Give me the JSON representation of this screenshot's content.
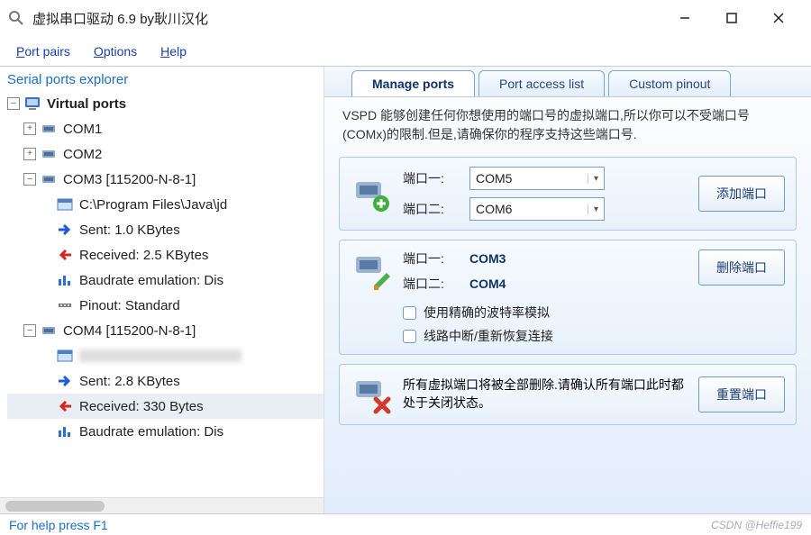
{
  "window": {
    "title": "虚拟串口驱动 6.9 by耿川汉化"
  },
  "menu": {
    "port_pairs": "Port pairs",
    "options": "Options",
    "help": "Help"
  },
  "tree": {
    "title": "Serial ports explorer",
    "root": "Virtual ports",
    "com1": "COM1",
    "com2": "COM2",
    "com3": "COM3 [115200-N-8-1]",
    "com3_path": "C:\\Program Files\\Java\\jd",
    "com3_sent": "Sent: 1.0 KBytes",
    "com3_recv": "Received: 2.5 KBytes",
    "com3_baud": "Baudrate emulation: Dis",
    "com3_pinout": "Pinout: Standard",
    "com4": "COM4 [115200-N-8-1]",
    "com4_path": " ",
    "com4_sent": "Sent: 2.8 KBytes",
    "com4_recv": "Received: 330 Bytes",
    "com4_baud": "Baudrate emulation: Dis"
  },
  "tabs": {
    "manage": "Manage ports",
    "access": "Port access list",
    "pinout": "Custom pinout"
  },
  "desc": "VSPD 能够创建任何你想使用的端口号的虚拟端口,所以你可以不受端口号(COMx)的限制.但是,请确保你的程序支持这些端口号.",
  "add": {
    "p1_label": "端口一:",
    "p1_value": "COM5",
    "p2_label": "端口二:",
    "p2_value": "COM6",
    "btn": "添加端口"
  },
  "del": {
    "p1_label": "端口一:",
    "p1_value": "COM3",
    "p2_label": "端口二:",
    "p2_value": "COM4",
    "chk1": "使用精确的波特率模拟",
    "chk2": "线路中断/重新恢复连接",
    "btn": "删除端口"
  },
  "reset": {
    "text": "所有虚拟端口将被全部删除.请确认所有端口此时都处于关闭状态。",
    "btn": "重置端口"
  },
  "status": {
    "help": "For help press F1",
    "watermark": "CSDN @Heffie199"
  }
}
